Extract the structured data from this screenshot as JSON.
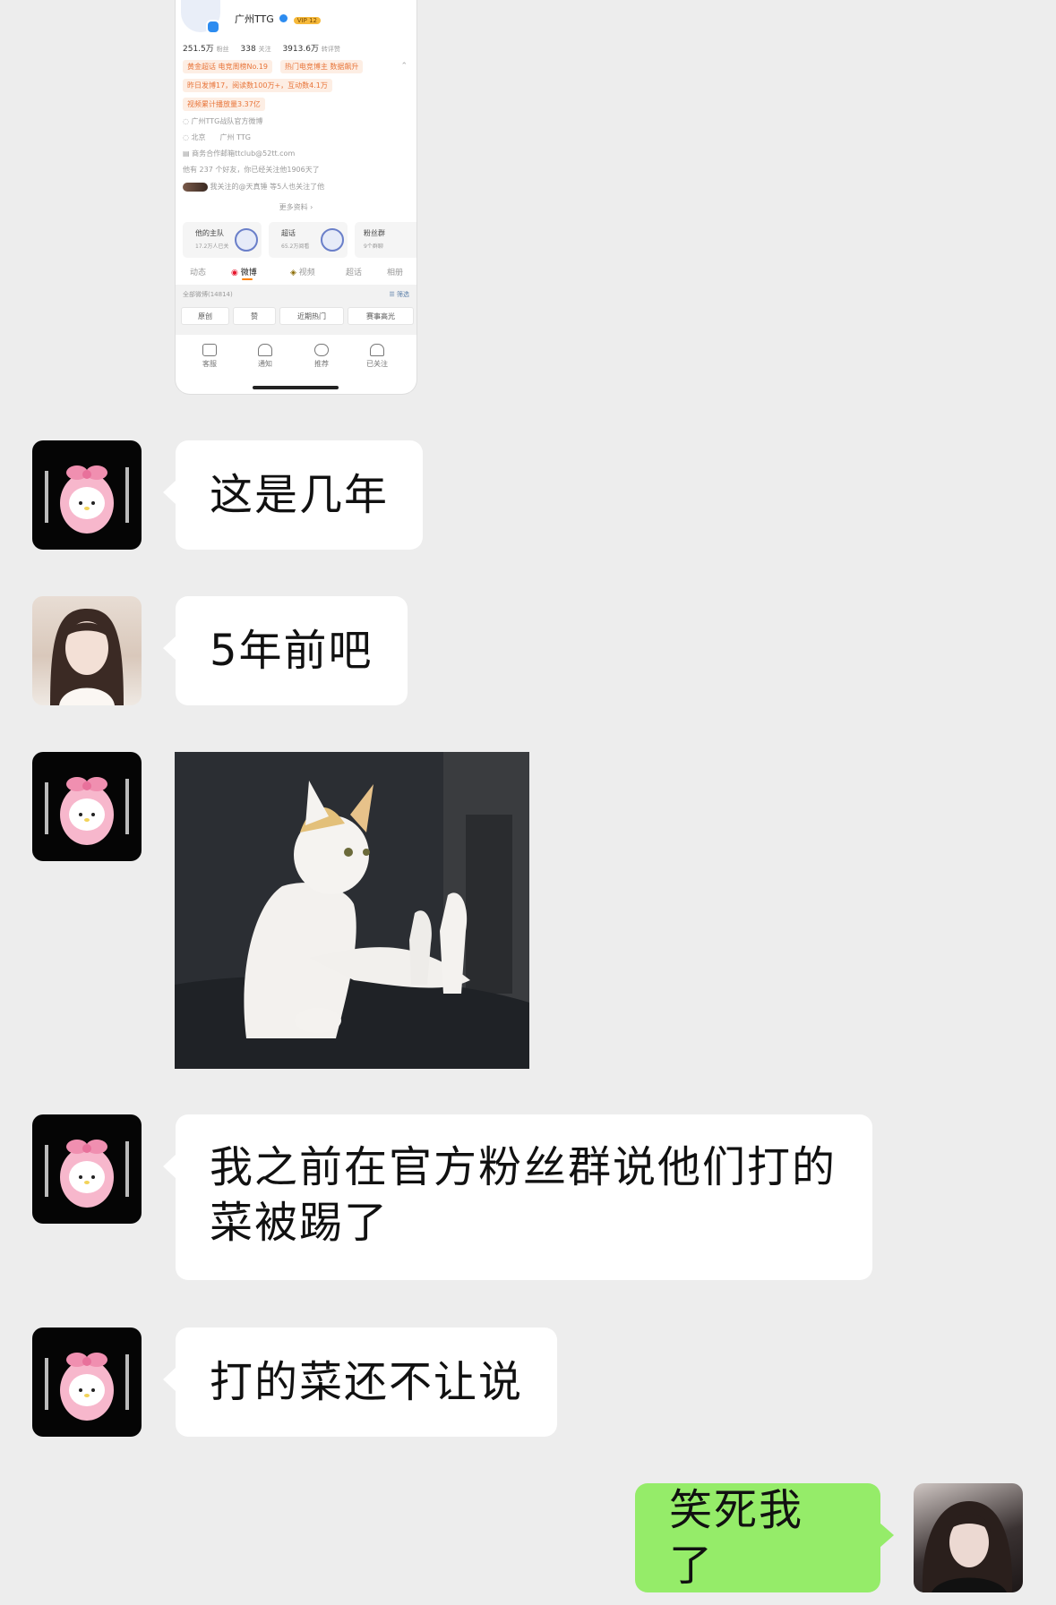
{
  "shared_screenshot": {
    "account_name": "广州TTG",
    "badge": "VIP 12",
    "stats": [
      {
        "value": "251.5万",
        "label": "粉丝"
      },
      {
        "value": "338",
        "label": "关注"
      },
      {
        "value": "3913.6万",
        "label": "转评赞"
      }
    ],
    "tags": [
      "黄金超话 电竞周榜No.19",
      "热门电竞博主 数据飙升"
    ],
    "tag_line2": "昨日发博17，阅读数100万+，互动数4.1万",
    "tag_line3": "视频累计播放量3.37亿",
    "info_lines": [
      "广州TTG战队官方微博",
      "北京　　广州 TTG",
      "商务合作邮箱ttclub@52tt.com"
    ],
    "friends_line": "他有 237 个好友，你已经关注他1906天了",
    "mutual_line": "我关注的@天真锤 等5人也关注了他",
    "more_link": "更多资料 ›",
    "tiles": [
      {
        "title": "他的主队",
        "sub": "17.2万人已关"
      },
      {
        "title": "超话",
        "sub": "65.2万阅看"
      },
      {
        "title": "粉丝群",
        "sub": "9个群聊"
      }
    ],
    "tabs": [
      "动态",
      "微博",
      "视频",
      "超话",
      "相册"
    ],
    "feed_header": "全部微博(14814)",
    "filter_label": "筛选",
    "filters": [
      "原创",
      "赞",
      "近期热门",
      "赛事高光"
    ],
    "bottom_nav": [
      "客服",
      "通知",
      "推荐",
      "已关注"
    ]
  },
  "messages": [
    {
      "text": "这是几年"
    },
    {
      "text": "5年前吧"
    },
    {
      "text": "我之前在官方粉丝群说他们打的菜被踢了"
    },
    {
      "text": "打的菜还不让说"
    },
    {
      "text": "笑死我了"
    }
  ],
  "colors": {
    "background": "#ededed",
    "bubble_incoming": "#ffffff",
    "bubble_outgoing": "#95ec69"
  }
}
